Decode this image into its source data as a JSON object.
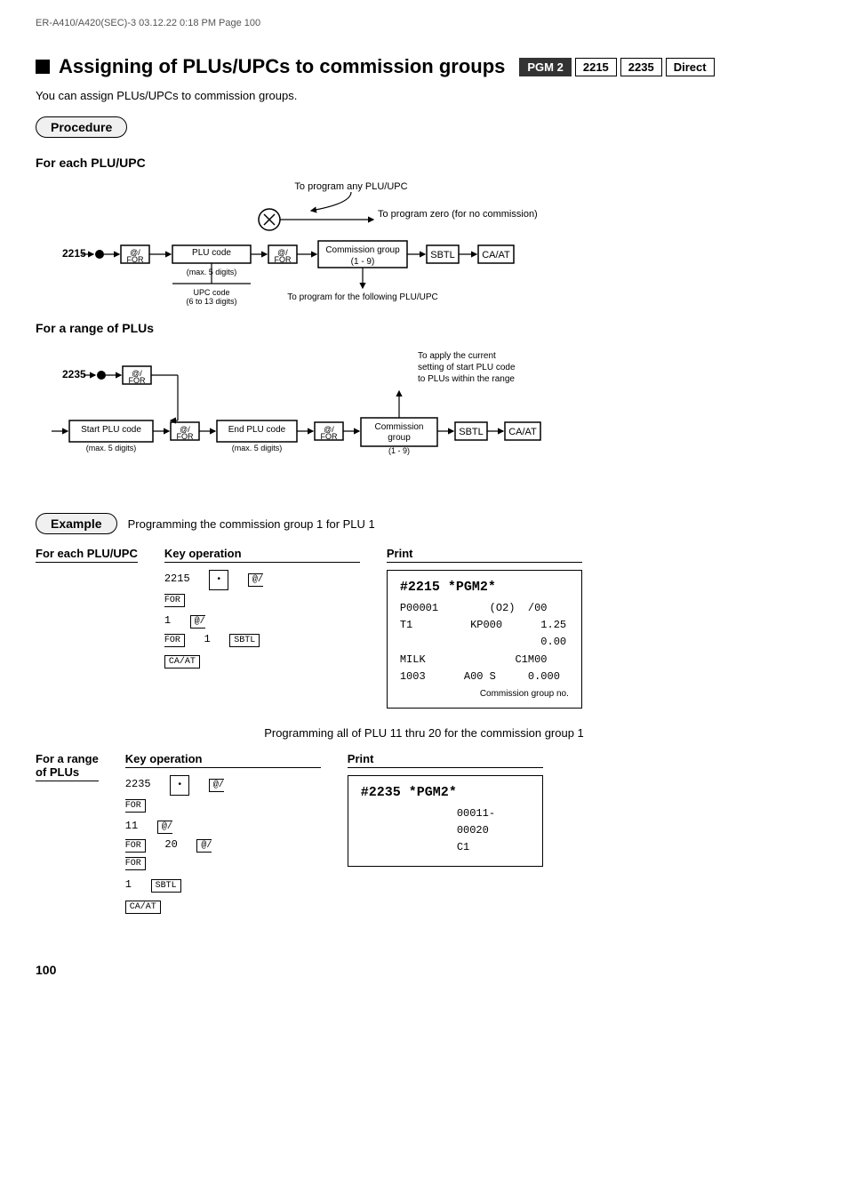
{
  "meta": {
    "header": "ER-A410/A420(SEC)-3  03.12.22 0:18 PM  Page 100"
  },
  "page": {
    "title": "Assigning of PLUs/UPCs to commission groups",
    "badges": [
      "PGM 2",
      "2215",
      "2235",
      "Direct"
    ],
    "subtitle": "You can assign PLUs/UPCs to commission groups.",
    "procedure_label": "Procedure",
    "example_label": "Example",
    "page_number": "100"
  },
  "section1": {
    "title": "For each PLU/UPC",
    "note_top": "To program any PLU/UPC",
    "note_zero": "To program zero (for no commission)",
    "note_next": "To program for the following PLU/UPC",
    "code_2215": "2215",
    "nodes": [
      "•",
      "@/FOR",
      "PLU code (max. 5 digits)",
      "UPC code (6 to 13 digits)",
      "@/FOR",
      "Commission group (1 - 9)",
      "SBTL",
      "CA/AT"
    ]
  },
  "section2": {
    "title": "For a range of PLUs",
    "note_apply": "To apply the current setting of start PLU code to PLUs within the range",
    "code_2235": "2235",
    "nodes": [
      "•",
      "@/FOR",
      "Start PLU code (max. 5 digits)",
      "@/FOR",
      "End PLU code (max. 5 digits)",
      "@/FOR",
      "Commission group (1 - 9)",
      "SBTL",
      "CA/AT"
    ]
  },
  "example": {
    "description": "Programming the commission group 1 for PLU 1",
    "col_each": "For each PLU/UPC",
    "col_key_op": "Key operation",
    "col_print": "Print",
    "key_lines": [
      "2215  •  @FOR",
      "1  @FOR  1  SBTL",
      "CA/AT"
    ],
    "print_header": "#2215 *PGM2*",
    "print_rows": [
      "P00001        (O2)  /00",
      "T1        KP000       1.25",
      "                      0.00",
      "MILK                C1M00",
      "1003      A00 S       0.000"
    ],
    "commission_note": "Commission group no."
  },
  "example2": {
    "description": "Programming all of PLU 11 thru 20 for the commission group 1",
    "col_range": "For a range",
    "col_range2": "of PLUs",
    "col_key_op": "Key operation",
    "col_print": "Print",
    "key_lines": [
      "2235  •  @FOR",
      "11  @FOR  20  @FOR",
      "1  SBTL",
      "CA/AT"
    ],
    "print_header": "#2235 *PGM2*",
    "print_rows": [
      "              00011-",
      "              00020",
      "              C1"
    ]
  }
}
